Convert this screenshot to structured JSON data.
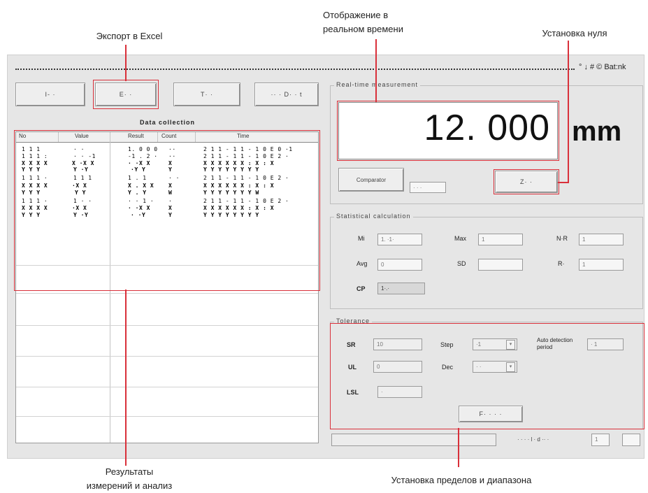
{
  "annotations": {
    "export": "Экспорт в Excel",
    "realtime_l1": "Отображение в",
    "realtime_l2": "реальном времени",
    "zero": "Установка нуля",
    "results_l1": "Результаты",
    "results_l2": "измерений и анализ",
    "limits": "Установка пределов и диапазона"
  },
  "status_right": "° ↓ # © Bat:nk",
  "toolbar": {
    "btn1": "I- ·",
    "btn2": "E·  ·",
    "btn3": "T·  ·",
    "btn4": "·· · D· · t"
  },
  "data_collection": {
    "title": "Data collection",
    "columns": [
      "No",
      "Value",
      "Result",
      "Count",
      "Time"
    ],
    "rows": [
      [
        "1 1 1",
        "· ·",
        "1. 0 0 0",
        "··",
        "2 1 1 - 1 1 - 1 0   E  0  ·1"
      ],
      [
        "1 1 1 :",
        "· · -1",
        "-1 . 2 ·",
        "··",
        "2 1 1 - 1 1 - 1 0   E  2  ·"
      ],
      [
        "X X X X",
        "X ·X X",
        "· ·X X",
        "X",
        "X X X  X  X  X  : X : X"
      ],
      [
        "Y Y Y",
        "Y ·Y",
        "·Y Y",
        "Y",
        "Y Y Y  Y  Y  Y  Y  Y"
      ],
      [
        "1 1 1 ·",
        "1 1 1",
        "1 . 1",
        "· ·",
        "2 1 1 - 1 1 - 1 0   E  2  ·"
      ],
      [
        "X X X X",
        "·X X",
        "X . X X",
        "X",
        "X X X  X  X  X  : X : X"
      ],
      [
        "Y Y Y",
        "Y Y",
        "Y . Y",
        "W",
        "Y Y Y  Y  Y  Y  Y  W"
      ],
      [
        "1 1 1 ·",
        "1 · ·",
        "· · 1 ·",
        "·",
        "2 1 1 - 1 1 - 1 0   E  2  ·"
      ],
      [
        "X X X X",
        "·X X",
        "· ·X X",
        "X",
        "X X X  X  X  X  : X : X"
      ],
      [
        "Y Y Y",
        "Y ·Y",
        "· ·Y",
        "Y",
        "Y Y Y  Y  Y  Y  Y  Y"
      ]
    ]
  },
  "realtime": {
    "legend": "Real-time measurement",
    "value": "12. 000",
    "unit": "mm",
    "comparator_label": "Comparator",
    "comparator_value": "· · ·",
    "zero_label": "Z· ·"
  },
  "statistics": {
    "legend": "Statistical calculation",
    "labels": [
      "Mi",
      "Max",
      "N·R",
      "Avg",
      "SD",
      "R·",
      "CP"
    ],
    "values": [
      "1. ·1·",
      "1",
      "1",
      "0",
      "",
      "1",
      "1·.·"
    ]
  },
  "limits": {
    "legend": "Tolerance",
    "labels": [
      "SR",
      "UL",
      "LSL",
      "Step",
      "Dec",
      "Auto detection period"
    ],
    "values": [
      "10",
      "0",
      "·",
      "·1",
      "· ·",
      "· 1"
    ],
    "set_button": "F· · · ·"
  },
  "status_bar": {
    "text": "· · · · l · d ·· ·",
    "field1": "1",
    "field2": ""
  },
  "colors": {
    "highlight": "#d9303a",
    "window_bg": "#e6e6e6"
  }
}
